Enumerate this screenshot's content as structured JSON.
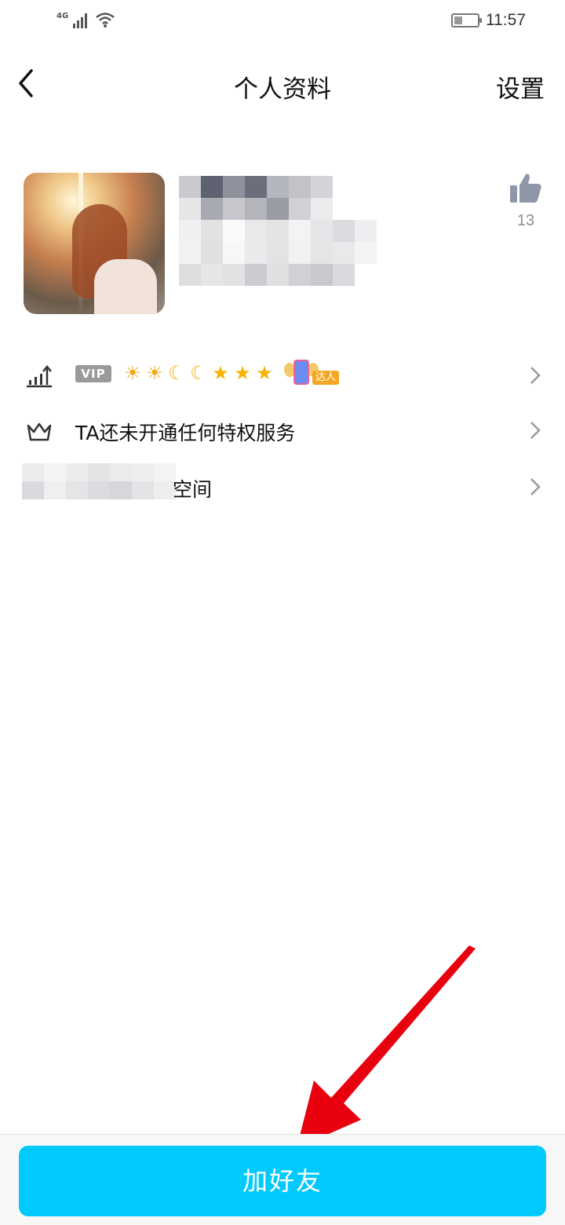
{
  "status_bar": {
    "network": "4G",
    "time": "11:57"
  },
  "header": {
    "title": "个人资料",
    "right_action": "设置"
  },
  "profile": {
    "like_count": "13"
  },
  "rows": {
    "privilege_text": "TA还未开通任何特权服务",
    "vip_label": "VIP",
    "daren_label": "达人",
    "space_suffix": "空间"
  },
  "actions": {
    "add_friend": "加好友"
  },
  "colors": {
    "primary_button": "#00cafc",
    "annotation_arrow": "#e8000f"
  }
}
